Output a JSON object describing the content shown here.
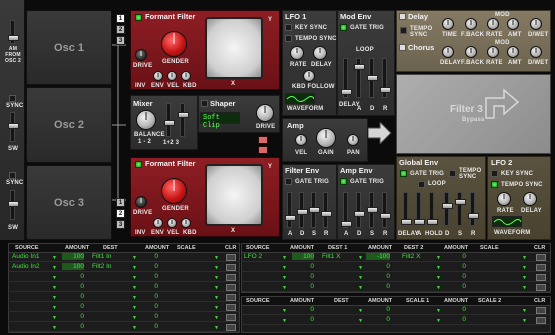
{
  "left_column": {
    "am_label": "AM FROM OSC 2",
    "sync1": "SYNC",
    "sw1": "SW",
    "sync2": "SYNC",
    "sw2": "SW"
  },
  "oscillators": [
    {
      "label": "Osc 1"
    },
    {
      "label": "Osc 2"
    },
    {
      "label": "Osc 3"
    }
  ],
  "formant_filter_top": {
    "title": "Formant Filter",
    "gender": "GENDER",
    "drive": "DRIVE",
    "bottom": [
      "INV",
      "ENV",
      "VEL",
      "KBD"
    ],
    "axes": {
      "x": "X",
      "y": "Y"
    },
    "routing_buttons": [
      "1",
      "2",
      "3"
    ]
  },
  "formant_filter_bottom": {
    "title": "Formant Filter",
    "gender": "GENDER",
    "drive": "DRIVE",
    "bottom": [
      "INV",
      "ENV",
      "VEL",
      "KBD"
    ],
    "axes": {
      "x": "X",
      "y": "Y"
    },
    "routing_buttons": [
      "1",
      "2",
      "3"
    ]
  },
  "mixer": {
    "title": "Mixer",
    "balance": "BALANCE",
    "balance_sub": "1 - 2",
    "sub2": "1+2   3"
  },
  "shaper": {
    "title": "Shaper",
    "mode": "Soft Clip",
    "drive": "DRIVE"
  },
  "amp": {
    "title": "Amp",
    "vel": "VEL",
    "gain": "GAIN",
    "pan": "PAN"
  },
  "lfo1": {
    "title": "LFO 1",
    "key_sync": "KEY SYNC",
    "tempo_sync": "TEMPO SYNC",
    "rate": "RATE",
    "delay": "DELAY",
    "kbd_follow": "KBD FOLLOW",
    "waveform": "WAVEFORM"
  },
  "mod_env": {
    "title": "Mod Env",
    "gate_trig": "GATE TRIG",
    "loop": "LOOP",
    "sliders": [
      "DELAY",
      "A",
      "D",
      "R"
    ]
  },
  "filter_env": {
    "title": "Filter Env",
    "gate_trig": "GATE TRIG",
    "sliders": [
      "A",
      "D",
      "S",
      "R"
    ]
  },
  "amp_env": {
    "title": "Amp Env",
    "gate_trig": "GATE TRIG",
    "sliders": [
      "A",
      "D",
      "S",
      "R"
    ]
  },
  "delay": {
    "title": "Delay",
    "tempo_sync": "TEMPO SYNC",
    "knobs": [
      "TIME",
      "F.BACK",
      "RATE",
      "AMT",
      "D/WET"
    ],
    "mod": "MOD"
  },
  "chorus": {
    "title": "Chorus",
    "knobs": [
      "DELAY",
      "F.BACK",
      "RATE",
      "AMT",
      "D/WET"
    ],
    "mod": "MOD"
  },
  "filter3": {
    "title": "Filter 3",
    "status": "Bypass"
  },
  "global_env": {
    "title": "Global Env",
    "gate_trig": "GATE TRIG",
    "tempo_sync": "TEMPO SYNC",
    "loop": "LOOP",
    "sliders": [
      "DELAY",
      "A",
      "HOLD",
      "D",
      "S",
      "R"
    ]
  },
  "lfo2": {
    "title": "LFO 2",
    "key_sync": "KEY SYNC",
    "tempo_sync": "TEMPO SYNC",
    "rate": "RATE",
    "delay": "DELAY",
    "waveform": "WAVEFORM"
  },
  "mod_bus_left": {
    "headers": [
      "SOURCE",
      "AMOUNT",
      "DEST",
      "AMOUNT",
      "SCALE"
    ],
    "clr": "CLR",
    "rows": [
      {
        "source": "Audio In1",
        "amount": "100",
        "dest": "Filt1 In",
        "amount2": "0",
        "scale": ""
      },
      {
        "source": "Audio In2",
        "amount": "100",
        "dest": "Filt2 In",
        "amount2": "0",
        "scale": ""
      },
      {
        "source": "",
        "amount": "0",
        "dest": "",
        "amount2": "0",
        "scale": ""
      },
      {
        "source": "",
        "amount": "0",
        "dest": "",
        "amount2": "0",
        "scale": ""
      },
      {
        "source": "",
        "amount": "0",
        "dest": "",
        "amount2": "0",
        "scale": ""
      },
      {
        "source": "",
        "amount": "0",
        "dest": "",
        "amount2": "0",
        "scale": ""
      },
      {
        "source": "",
        "amount": "0",
        "dest": "",
        "amount2": "0",
        "scale": ""
      },
      {
        "source": "",
        "amount": "0",
        "dest": "",
        "amount2": "0",
        "scale": ""
      }
    ]
  },
  "mod_bus_right_top": {
    "headers": [
      "SOURCE",
      "AMOUNT",
      "DEST 1",
      "AMOUNT",
      "DEST 2",
      "AMOUNT",
      "SCALE"
    ],
    "clr": "CLR",
    "rows": [
      {
        "source": "LFO 2",
        "amount": "100",
        "dest1": "Filt1 X",
        "amount2": "-100",
        "dest2": "Filt2 X",
        "amount3": "0",
        "scale": ""
      },
      {
        "source": "",
        "amount": "0",
        "dest1": "",
        "amount2": "0",
        "dest2": "",
        "amount3": "0",
        "scale": ""
      },
      {
        "source": "",
        "amount": "0",
        "dest1": "",
        "amount2": "0",
        "dest2": "",
        "amount3": "0",
        "scale": ""
      },
      {
        "source": "",
        "amount": "0",
        "dest1": "",
        "amount2": "0",
        "dest2": "",
        "amount3": "0",
        "scale": ""
      }
    ]
  },
  "mod_bus_right_bottom": {
    "headers": [
      "SOURCE",
      "AMOUNT",
      "DEST",
      "AMOUNT",
      "SCALE 1",
      "AMOUNT",
      "SCALE 2"
    ],
    "clr": "CLR",
    "rows": [
      {
        "source": "",
        "amount": "0",
        "dest": "",
        "amount2": "0",
        "scale1": "",
        "amount3": "0",
        "scale2": ""
      },
      {
        "source": "",
        "amount": "0",
        "dest": "",
        "amount2": "0",
        "scale1": "",
        "amount3": "0",
        "scale2": ""
      }
    ]
  }
}
